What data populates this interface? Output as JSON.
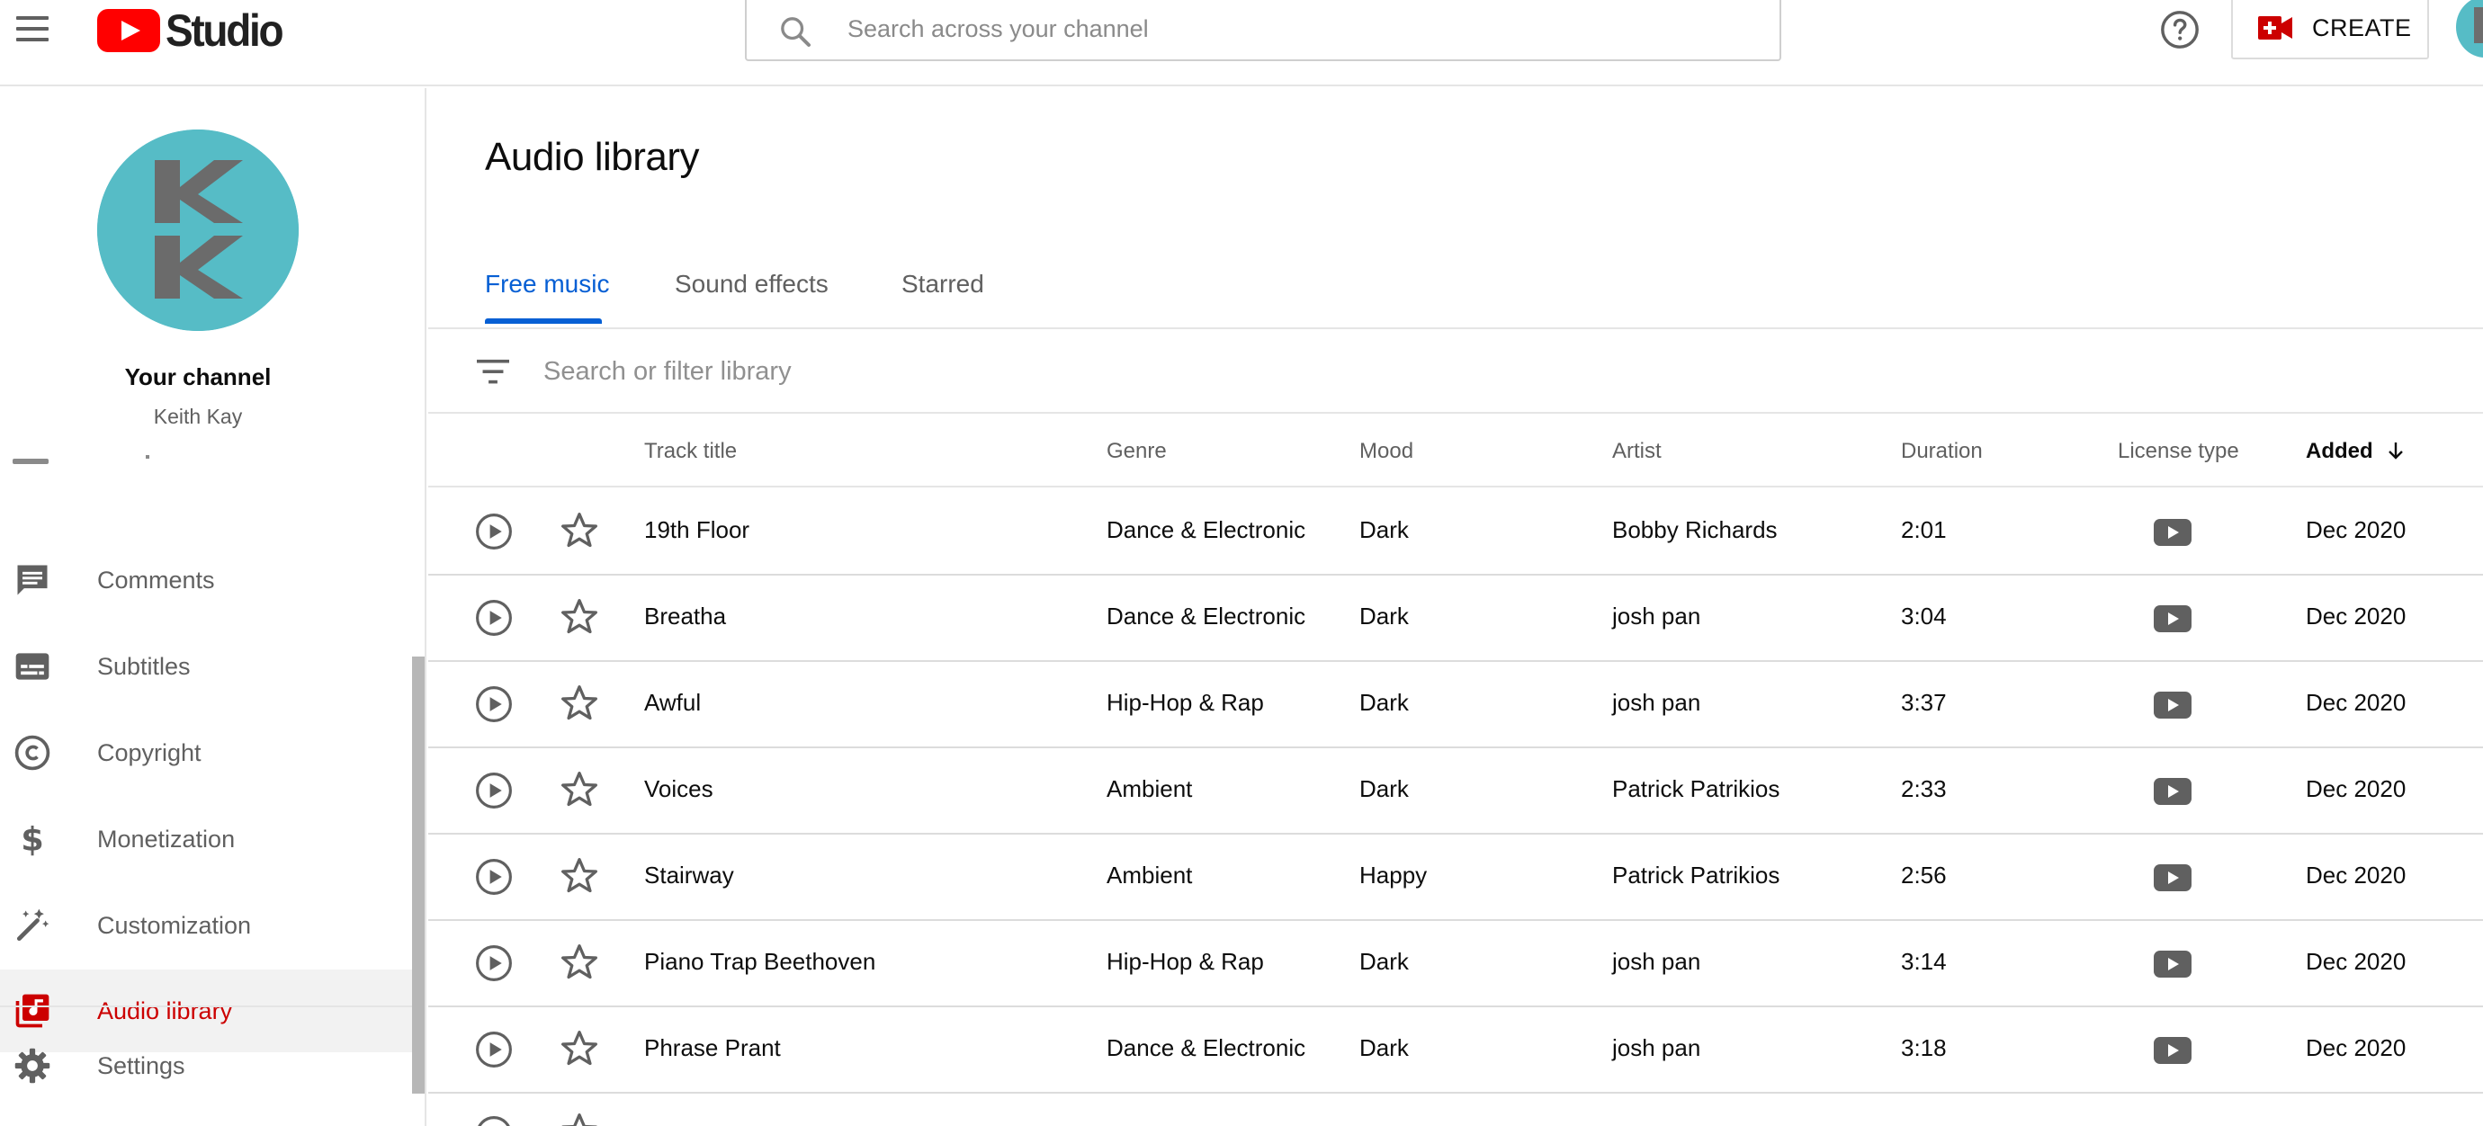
{
  "header": {
    "logo_text": "Studio",
    "search_placeholder": "Search across your channel",
    "create_label": "CREATE"
  },
  "sidebar": {
    "channel_title": "Your channel",
    "channel_name": "Keith Kay",
    "items": [
      {
        "label": "Comments",
        "icon": "comments-icon"
      },
      {
        "label": "Subtitles",
        "icon": "subtitles-icon"
      },
      {
        "label": "Copyright",
        "icon": "copyright-icon"
      },
      {
        "label": "Monetization",
        "icon": "dollar-icon"
      },
      {
        "label": "Customization",
        "icon": "magic-wand-icon"
      },
      {
        "label": "Audio library",
        "icon": "audio-library-icon",
        "active": true
      },
      {
        "label": "Settings",
        "icon": "gear-icon"
      }
    ]
  },
  "main": {
    "page_title": "Audio library",
    "tabs": [
      {
        "label": "Free music",
        "active": true
      },
      {
        "label": "Sound effects"
      },
      {
        "label": "Starred"
      }
    ],
    "filter_placeholder": "Search or filter library",
    "columns": {
      "track_title": "Track title",
      "genre": "Genre",
      "mood": "Mood",
      "artist": "Artist",
      "duration": "Duration",
      "license_type": "License type",
      "added": "Added"
    },
    "rows": [
      {
        "title": "19th Floor",
        "genre": "Dance & Electronic",
        "mood": "Dark",
        "artist": "Bobby Richards",
        "duration": "2:01",
        "added": "Dec 2020"
      },
      {
        "title": "Breatha",
        "genre": "Dance & Electronic",
        "mood": "Dark",
        "artist": "josh pan",
        "duration": "3:04",
        "added": "Dec 2020"
      },
      {
        "title": "Awful",
        "genre": "Hip-Hop & Rap",
        "mood": "Dark",
        "artist": "josh pan",
        "duration": "3:37",
        "added": "Dec 2020"
      },
      {
        "title": "Voices",
        "genre": "Ambient",
        "mood": "Dark",
        "artist": "Patrick Patrikios",
        "duration": "2:33",
        "added": "Dec 2020"
      },
      {
        "title": "Stairway",
        "genre": "Ambient",
        "mood": "Happy",
        "artist": "Patrick Patrikios",
        "duration": "2:56",
        "added": "Dec 2020"
      },
      {
        "title": "Piano Trap Beethoven",
        "genre": "Hip-Hop & Rap",
        "mood": "Dark",
        "artist": "josh pan",
        "duration": "3:14",
        "added": "Dec 2020"
      },
      {
        "title": "Phrase Prant",
        "genre": "Dance & Electronic",
        "mood": "Dark",
        "artist": "josh pan",
        "duration": "3:18",
        "added": "Dec 2020"
      }
    ]
  },
  "colors": {
    "accent_blue": "#065fd4",
    "brand_red": "#ff0000",
    "active_red": "#cc0000",
    "channel_teal": "#56bcc6"
  }
}
